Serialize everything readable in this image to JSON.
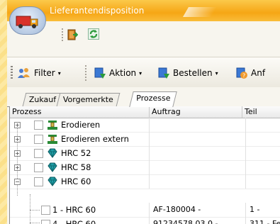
{
  "window": {
    "title": "Lieferantendisposition"
  },
  "toolbar": {
    "filter_label": "Filter",
    "aktion_label": "Aktion",
    "bestellen_label": "Bestellen",
    "next_label_partial": "Anf"
  },
  "tabs": [
    {
      "label": "Zukauf",
      "active": false
    },
    {
      "label": "Vorgemerkte",
      "active": false
    },
    {
      "label": "Prozesse",
      "active": true
    }
  ],
  "grid": {
    "columns": [
      "Prozess",
      "Auftrag",
      "Teil"
    ],
    "rows": [
      {
        "label": "Erodieren",
        "icon": "machine-icon",
        "expand": "+",
        "auftrag": "",
        "teil": ""
      },
      {
        "label": "Erodieren extern",
        "icon": "machine-icon",
        "expand": "+",
        "auftrag": "",
        "teil": ""
      },
      {
        "label": "HRC 52",
        "icon": "diamond-icon",
        "expand": "+",
        "auftrag": "",
        "teil": ""
      },
      {
        "label": "HRC 58",
        "icon": "diamond-icon",
        "expand": "+",
        "auftrag": "",
        "teil": ""
      },
      {
        "label": "HRC 60",
        "icon": "diamond-icon",
        "expand": "−",
        "auftrag": "",
        "teil": ""
      },
      {
        "label": "1 - HRC 60",
        "icon": "",
        "expand": "",
        "auftrag": "AF-180004 -",
        "teil": "1 -"
      },
      {
        "label": "4 - HRC 60",
        "icon": "",
        "expand": "",
        "auftrag": "91234578.03.0 -",
        "teil": "311 - Fer"
      }
    ]
  },
  "colors": {
    "titlebar": "#f6a615",
    "accent_green": "#2a9a3a",
    "diamond": "#1f9ea6"
  }
}
